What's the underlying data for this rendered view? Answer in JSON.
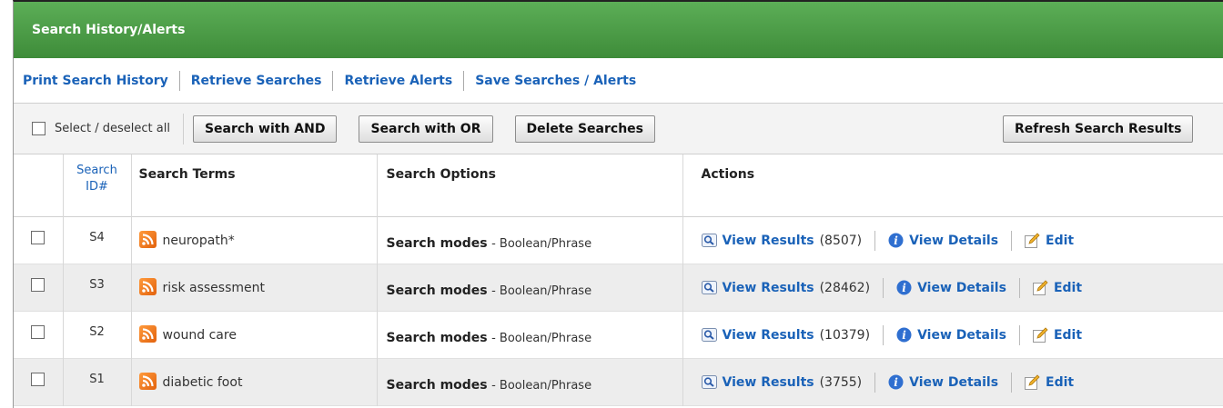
{
  "title": "Search History/Alerts",
  "links": [
    "Print Search History",
    "Retrieve Searches",
    "Retrieve Alerts",
    "Save Searches / Alerts"
  ],
  "toolbar": {
    "select_all": "Select / deselect all",
    "and_btn": "Search with AND",
    "or_btn": "Search with OR",
    "delete_btn": "Delete Searches",
    "refresh_btn": "Refresh Search Results"
  },
  "columns": {
    "id_line1": "Search",
    "id_line2": "ID#",
    "terms": "Search Terms",
    "options": "Search Options",
    "actions": "Actions"
  },
  "row_labels": {
    "mode": "Search modes",
    "view_results": "View Results",
    "view_details": "View Details",
    "edit": "Edit"
  },
  "rows": [
    {
      "id": "S4",
      "terms": "neuropath*",
      "mode_value": "- Boolean/Phrase",
      "count": "(8507)"
    },
    {
      "id": "S3",
      "terms": "risk assessment",
      "mode_value": "- Boolean/Phrase",
      "count": "(28462)"
    },
    {
      "id": "S2",
      "terms": "wound care",
      "mode_value": "- Boolean/Phrase",
      "count": "(10379)"
    },
    {
      "id": "S1",
      "terms": "diabetic foot",
      "mode_value": "- Boolean/Phrase",
      "count": "(3755)"
    }
  ],
  "colors": {
    "header_green": "#4a9a45",
    "link_blue": "#1a62b8",
    "alt_row": "#ededed"
  },
  "icons": {
    "rss": "rss-feed-icon",
    "view_results": "magnifier-icon",
    "view_details": "info-icon",
    "edit": "pencil-icon"
  }
}
